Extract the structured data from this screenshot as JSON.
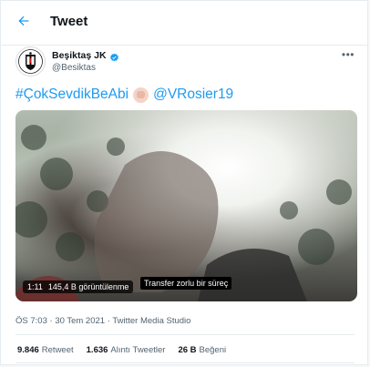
{
  "header": {
    "title": "Tweet",
    "back_icon": "arrow-left-icon"
  },
  "author": {
    "display_name": "Beşiktaş JK",
    "handle": "@Besiktas",
    "verified": true,
    "more_icon": "more-horizontal-icon",
    "more_label": "•••"
  },
  "tweet": {
    "hashtag": "#ÇokSevdikBeAbi",
    "mention": "@VRosier19",
    "emoji_icon": "raised-fist-icon"
  },
  "video": {
    "duration": "1:11",
    "views": "145,4 B görüntülenme",
    "caption": "Transfer zorlu bir süreç"
  },
  "meta": {
    "time": "ÖS 7:03",
    "separator1": " · ",
    "date": "30 Tem 2021",
    "separator2": " · ",
    "source": "Twitter Media Studio"
  },
  "stats": [
    {
      "count": "9.846",
      "label": "Retweet"
    },
    {
      "count": "1.636",
      "label": "Alıntı Tweetler"
    },
    {
      "count": "26 B",
      "label": "Beğeni"
    }
  ],
  "colors": {
    "accent": "#1d9bf0",
    "text": "#0f1419",
    "muted": "#536471",
    "border": "#e6ecf0"
  }
}
